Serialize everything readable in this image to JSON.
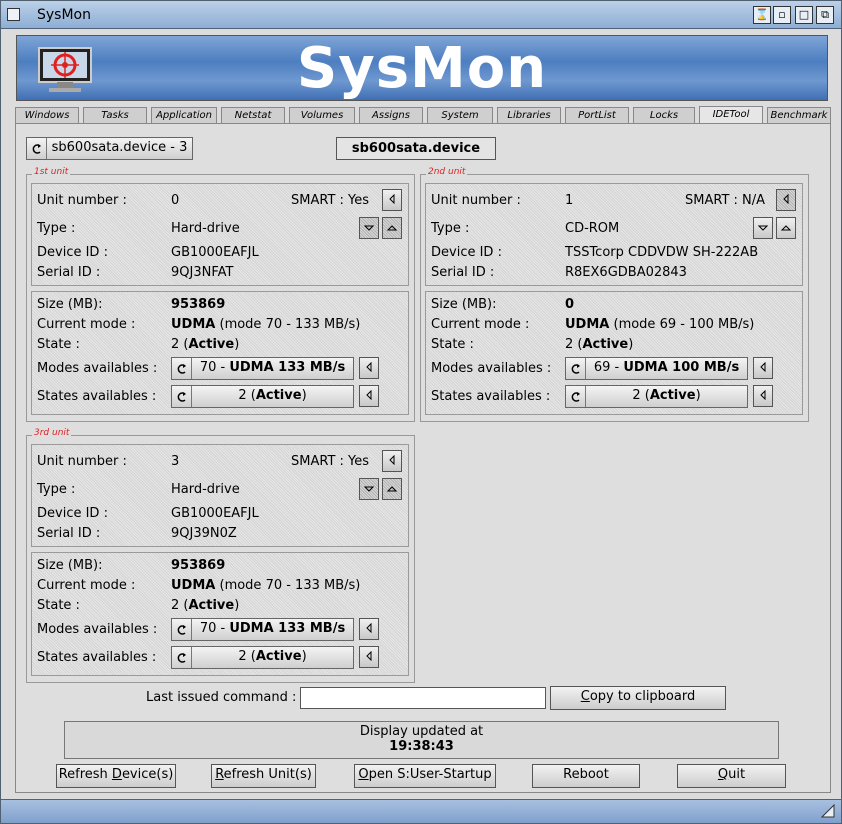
{
  "window": {
    "title": "SysMon"
  },
  "banner": {
    "title": "SysMon"
  },
  "tabs": [
    "Windows",
    "Tasks",
    "Application",
    "Netstat",
    "Volumes",
    "Assigns",
    "System",
    "Libraries",
    "PortList",
    "Locks",
    "IDETool",
    "Benchmark"
  ],
  "active_tab": "IDETool",
  "device_cycle": "sb600sata.device - 3",
  "device_name": "sb600sata.device",
  "labels": {
    "unit_number": "Unit number :",
    "smart": "SMART :",
    "type": "Type :",
    "device_id": "Device ID :",
    "serial_id": "Serial ID :",
    "size": "Size (MB):",
    "current_mode": "Current mode :",
    "state": "State :",
    "modes_available": "Modes availables :",
    "states_available": "States availables :"
  },
  "units": [
    {
      "frame": "1st unit",
      "unit_number": "0",
      "smart": "Yes",
      "type": "Hard-drive",
      "device_id": "GB1000EAFJL",
      "serial_id": "9QJ3NFAT",
      "size": "953869",
      "mode_bold": "UDMA",
      "mode_rest": " (mode 70 - 133 MB/s)",
      "state_num": "2 (",
      "state_bold": "Active",
      "state_end": ")",
      "mode_cycle_num": "70 - ",
      "mode_cycle_bold": "UDMA 133 MB/s",
      "state_cycle_num": "2 (",
      "state_cycle_bold": "Active",
      "state_cycle_end": ")"
    },
    {
      "frame": "2nd unit",
      "unit_number": "1",
      "smart": "N/A",
      "type": "CD-ROM",
      "device_id": "TSSTcorp CDDVDW SH-222AB",
      "serial_id": "R8EX6GDBA02843",
      "size": "0",
      "mode_bold": "UDMA",
      "mode_rest": " (mode 69 - 100 MB/s)",
      "state_num": "2 (",
      "state_bold": "Active",
      "state_end": ")",
      "mode_cycle_num": "69 - ",
      "mode_cycle_bold": "UDMA 100 MB/s",
      "state_cycle_num": "2 (",
      "state_cycle_bold": "Active",
      "state_cycle_end": ")"
    },
    {
      "frame": "3rd unit",
      "unit_number": "3",
      "smart": "Yes",
      "type": "Hard-drive",
      "device_id": "GB1000EAFJL",
      "serial_id": "9QJ39N0Z",
      "size": "953869",
      "mode_bold": "UDMA",
      "mode_rest": " (mode 70 - 133 MB/s)",
      "state_num": "2 (",
      "state_bold": "Active",
      "state_end": ")",
      "mode_cycle_num": "70 - ",
      "mode_cycle_bold": "UDMA 133 MB/s",
      "state_cycle_num": "2 (",
      "state_cycle_bold": "Active",
      "state_cycle_end": ")"
    }
  ],
  "last_command": {
    "label": "Last issued command :",
    "value": "",
    "copy": {
      "key": "C",
      "rest": "opy to clipboard"
    }
  },
  "status": {
    "line1": "Display updated at",
    "time": "19:38:43"
  },
  "buttons": {
    "refresh_device": {
      "pre": "Refresh ",
      "key": "D",
      "post": "evice(s)"
    },
    "refresh_unit": {
      "pre": "",
      "key": "R",
      "post": "efresh Unit(s)"
    },
    "open_startup": {
      "pre": "",
      "key": "O",
      "post": "pen S:User-Startup"
    },
    "reboot": "Reboot",
    "quit": {
      "pre": "",
      "key": "Q",
      "post": "uit"
    }
  }
}
